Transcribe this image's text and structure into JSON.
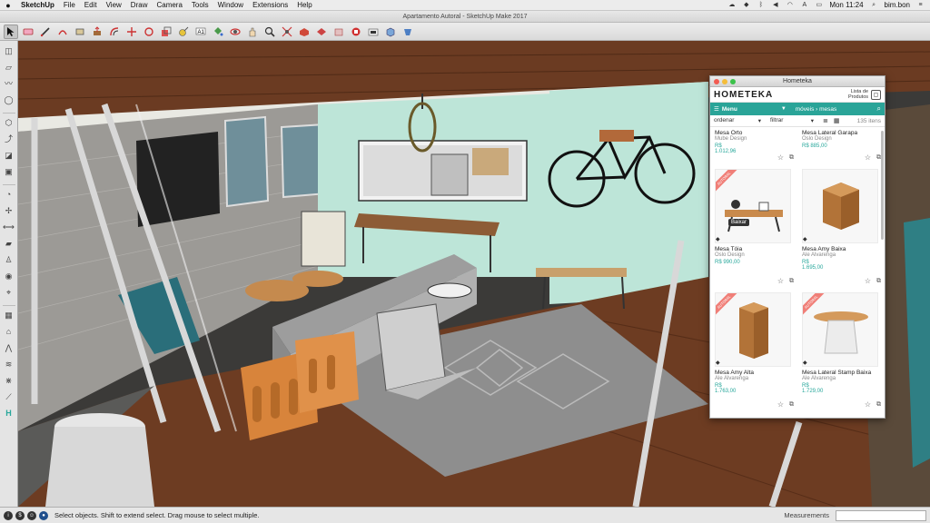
{
  "menubar": {
    "app": "SketchUp",
    "items": [
      "File",
      "Edit",
      "View",
      "Draw",
      "Camera",
      "Tools",
      "Window",
      "Extensions",
      "Help"
    ],
    "clock": "Mon 11:24",
    "user": "bim.bon"
  },
  "window": {
    "title": "Apartamento Autoral - SketchUp Make 2017"
  },
  "statusbar": {
    "hint": "Select objects. Shift to extend select. Drag mouse to select multiple.",
    "measurements_label": "Measurements"
  },
  "hometeka": {
    "window_title": "Hometeka",
    "logo": "HOMETEKA",
    "list_label_1": "Lista de",
    "list_label_2": "Produtos",
    "menu_label": "Menu",
    "breadcrumb": "móveis › mesas",
    "sort_label": "ordenar",
    "filter_label": "filtrar",
    "count": "135 itens",
    "tooltip": "Baixar",
    "ribbon": "AUTORAL",
    "products": [
      {
        "name": "Mesa Orto",
        "maker": "Mube Design",
        "price_prefix": "R$",
        "price": "1.012,96"
      },
      {
        "name": "Mesa Lateral Garapa",
        "maker": "Oslo Design",
        "price_prefix": "R$",
        "price": "885,00"
      },
      {
        "name": "Mesa Tóia",
        "maker": "Oslo Design",
        "price_prefix": "R$",
        "price": "990,00"
      },
      {
        "name": "Mesa Amy Baixa",
        "maker": "Ale Alvarenga",
        "price_prefix": "R$",
        "price": "1.695,00"
      },
      {
        "name": "Mesa Amy Alta",
        "maker": "Ale Alvarenga",
        "price_prefix": "R$",
        "price": "1.763,00"
      },
      {
        "name": "Mesa Lateral Stamp Baixa",
        "maker": "Ale Alvarenga",
        "price_prefix": "R$",
        "price": "1.729,00"
      }
    ]
  },
  "colors": {
    "accent": "#2aa498",
    "ribbon": "#f07f78",
    "floor": "#7a4a2a",
    "wall_mint": "#bde5d8"
  }
}
